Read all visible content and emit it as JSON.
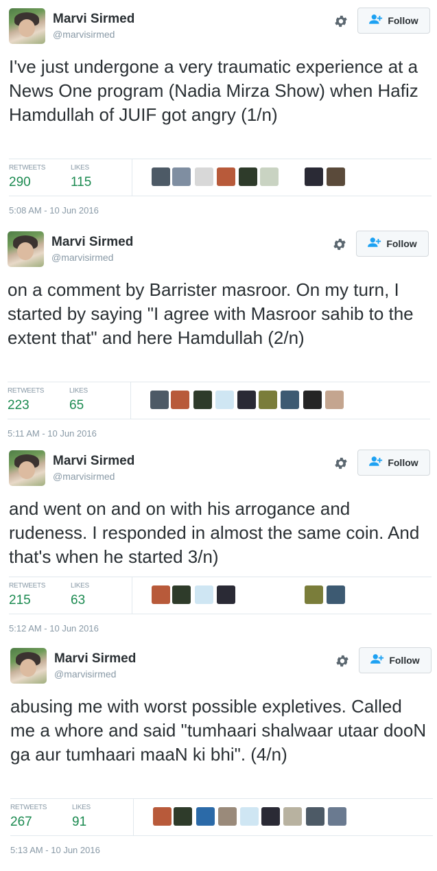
{
  "tweets": [
    {
      "name": "Marvi Sirmed",
      "handle": "@marvisirmed",
      "follow_label": "Follow",
      "text": "I've just undergone a very traumatic experience at a News One program (Nadia Mirza Show) when Hafiz Hamdullah of JUIF got angry (1/n)",
      "retweets_label": "RETWEETS",
      "retweets": "290",
      "likes_label": "LIKES",
      "likes": "115",
      "timestamp": "5:08 AM - 10 Jun 2016",
      "liker_colors": [
        "#4d5a66",
        "#7f8ea1",
        "#d8d8d8",
        "#b85a3a",
        "#2e3b2a",
        "#c9d3c2",
        "#ffffff",
        "#2a2a35",
        "#5a4a3a"
      ]
    },
    {
      "name": "Marvi Sirmed",
      "handle": "@marvisirmed",
      "follow_label": "Follow",
      "text": "on a comment by Barrister masroor. On my turn, I started by saying \"I agree with Masroor sahib to the extent that\" and here Hamdullah (2/n)",
      "retweets_label": "RETWEETS",
      "retweets": "223",
      "likes_label": "LIKES",
      "likes": "65",
      "timestamp": "5:11 AM - 10 Jun 2016",
      "liker_colors": [
        "#4d5a66",
        "#b85a3a",
        "#2e3b2a",
        "#cfe6f3",
        "#2a2a35",
        "#7a7d3a",
        "#3d5a72",
        "#242424",
        "#c4a58f"
      ]
    },
    {
      "name": "Marvi Sirmed",
      "handle": "@marvisirmed",
      "follow_label": "Follow",
      "text": "and went on and on with his arrogance and rudeness. I responded in almost the same coin. And that's when he started 3/n)",
      "retweets_label": "RETWEETS",
      "retweets": "215",
      "likes_label": "LIKES",
      "likes": "63",
      "timestamp": "5:12 AM - 10 Jun 2016",
      "liker_colors": [
        "#b85a3a",
        "#2e3b2a",
        "#cfe6f3",
        "#2a2a35",
        "#ffffff",
        "#ffffff",
        "#ffffff",
        "#7a7d3a",
        "#3d5a72"
      ]
    },
    {
      "name": "Marvi Sirmed",
      "handle": "@marvisirmed",
      "follow_label": "Follow",
      "text": "abusing me with worst possible expletives. Called me a whore and said \"tumhaari shalwaar utaar dooN ga aur tumhaari maaN ki bhi\". (4/n)",
      "retweets_label": "RETWEETS",
      "retweets": "267",
      "likes_label": "LIKES",
      "likes": "91",
      "timestamp": "5:13 AM - 10 Jun 2016",
      "liker_colors": [
        "#b85a3a",
        "#2e3b2a",
        "#2b6aa8",
        "#9a8a7a",
        "#cfe6f3",
        "#2a2a35",
        "#b8b2a0",
        "#4d5a66",
        "#6a7a90"
      ]
    }
  ]
}
